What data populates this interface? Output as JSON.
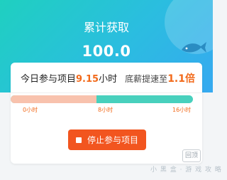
{
  "header": {
    "title": "累计获取",
    "total": "100.0"
  },
  "card": {
    "today_label": "今日参与项目",
    "today_hours": "9.15",
    "hours_unit": "小时",
    "speed_label": "底薪提速至",
    "speed_value": "1.1",
    "speed_unit": "倍"
  },
  "progress": {
    "value_hours": 9.15,
    "fill_fraction": 0.47,
    "ticks": [
      "0小时",
      "8小时",
      "16小时"
    ]
  },
  "actions": {
    "stop_label": "停止参与项目"
  },
  "side_badge": "回顶",
  "watermark": "小 黑 盒 · 游 戏 攻 略",
  "colors": {
    "accent": "#f26a1b",
    "header_start": "#1fd0c0",
    "header_end": "#36a9f0",
    "progress_fill": "#f8c2ad",
    "progress_track": "#48d0bd"
  }
}
